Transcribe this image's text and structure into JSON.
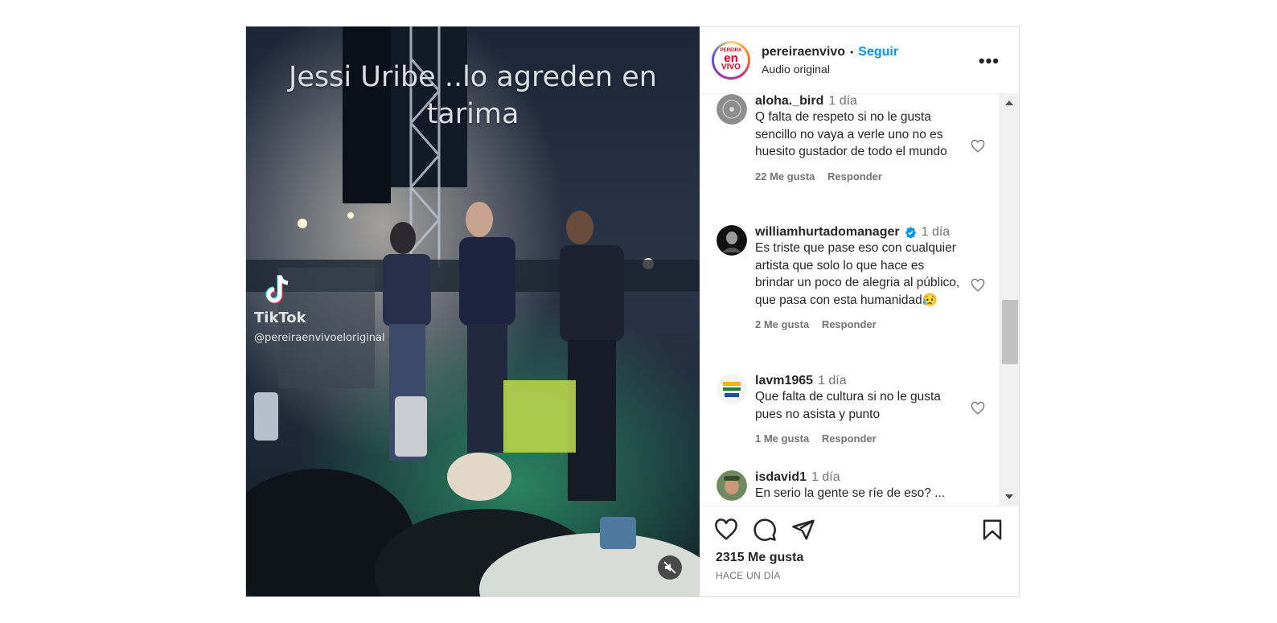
{
  "video": {
    "overlay_title": "Jessi Uribe ..lo agreden en tarima",
    "tiktok_label": "TikTok",
    "tiktok_user": "@pereiraenvivoeloriginal"
  },
  "header": {
    "username": "pereiraenvivo",
    "separator": "•",
    "follow_label": "Seguir",
    "audio_label": "Audio original",
    "more_label": "•••",
    "avatar_logo": {
      "top": "PEREIRA",
      "mid": "en",
      "bot": "VIVO"
    }
  },
  "comments": [
    {
      "user": "aloha._bird",
      "time": "1 día",
      "text": "Q falta de respeto si no le gusta sencillo no vaya a verle uno no es huesito gustador de todo el mundo",
      "likes": "22 Me gusta",
      "reply": "Responder",
      "verified": false
    },
    {
      "user": "williamhurtadomanager",
      "time": "1 día",
      "text": "Es triste que pase eso con cualquier artista que solo lo que hace es brindar un poco de alegria al público, que pasa con esta humanidad😥",
      "likes": "2 Me gusta",
      "reply": "Responder",
      "verified": true
    },
    {
      "user": "lavm1965",
      "time": "1 día",
      "text": "Que falta de cultura si no le gusta pues no asista y punto",
      "likes": "1 Me gusta",
      "reply": "Responder",
      "verified": false
    },
    {
      "user": "isdavid1",
      "time": "1 día",
      "text": "En serio la gente se ríe de eso? ...",
      "likes": "",
      "reply": "",
      "verified": false
    }
  ],
  "footer": {
    "likes_count": "2315 Me gusta",
    "posted": "HACE UN DÍA"
  },
  "icons": {
    "like": "heart-icon",
    "comment": "comment-icon",
    "share": "share-icon",
    "save": "bookmark-icon",
    "mute": "speaker-muted-icon"
  },
  "colors": {
    "follow_blue": "#0095f6",
    "text_primary": "#262626",
    "text_secondary": "#737373",
    "verified_blue": "#0095f6"
  }
}
